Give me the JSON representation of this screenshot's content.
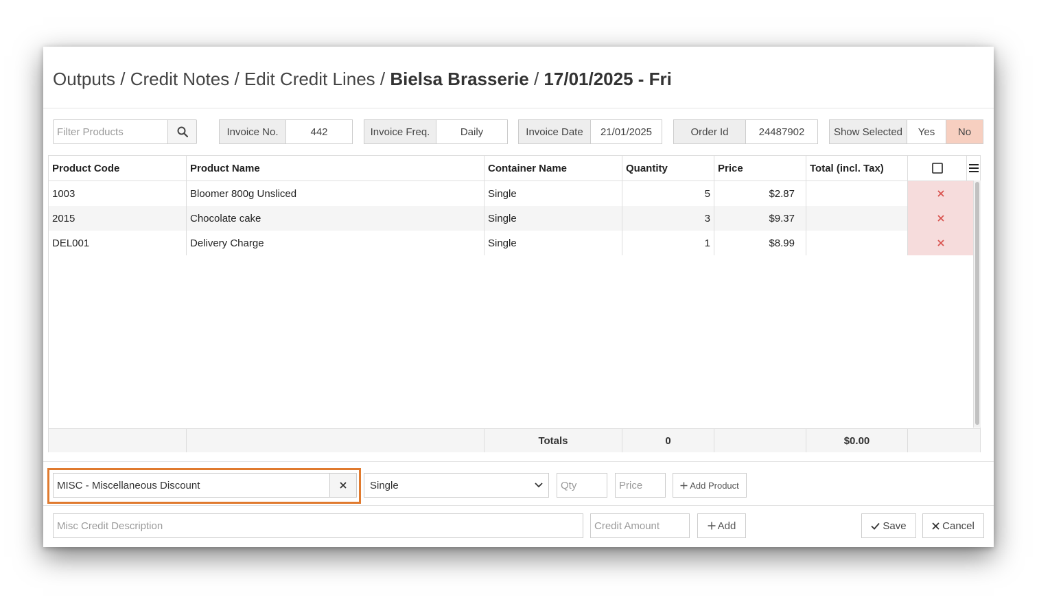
{
  "title": {
    "path": "Outputs / Credit Notes / Edit Credit Lines /",
    "customer": "Bielsa Brasserie",
    "sep": "/",
    "date": "17/01/2025 - Fri"
  },
  "toolbar": {
    "filter_placeholder": "Filter Products",
    "invoice_no_label": "Invoice No.",
    "invoice_no": "442",
    "invoice_freq_label": "Invoice Freq.",
    "invoice_freq": "Daily",
    "invoice_date_label": "Invoice Date",
    "invoice_date": "21/01/2025",
    "order_id_label": "Order Id",
    "order_id": "24487902",
    "show_selected_label": "Show Selected",
    "yes": "Yes",
    "no": "No"
  },
  "grid": {
    "headers": [
      "Product Code",
      "Product Name",
      "Container Name",
      "Quantity",
      "Price",
      "Total (incl. Tax)"
    ],
    "rows": [
      {
        "code": "1003",
        "name": "Bloomer 800g Unsliced",
        "container": "Single",
        "qty": "5",
        "price": "$2.87",
        "total": ""
      },
      {
        "code": "2015",
        "name": "Chocolate cake",
        "container": "Single",
        "qty": "3",
        "price": "$9.37",
        "total": ""
      },
      {
        "code": "DEL001",
        "name": "Delivery Charge",
        "container": "Single",
        "qty": "1",
        "price": "$8.99",
        "total": ""
      }
    ],
    "totals_label": "Totals",
    "totals_qty": "0",
    "totals_amount": "$0.00"
  },
  "add_product": {
    "product_value": "MISC - Miscellaneous Discount",
    "container_value": "Single",
    "qty_placeholder": "Qty",
    "price_placeholder": "Price",
    "add_label": "Add Product"
  },
  "misc_credit": {
    "description_placeholder": "Misc Credit Description",
    "amount_placeholder": "Credit Amount",
    "add_label": "Add"
  },
  "actions": {
    "save_label": "Save",
    "cancel_label": "Cancel"
  },
  "colors": {
    "highlight": "#e07a2e",
    "no_active": "#f7cfc0",
    "delete_bg": "#f6dcdc",
    "delete_icon": "#d9534f"
  },
  "icons": [
    "search-icon",
    "checkbox-icon",
    "menu-icon",
    "delete-icon",
    "clear-icon",
    "chevron-down-icon",
    "plus-icon",
    "check-icon",
    "close-icon"
  ]
}
